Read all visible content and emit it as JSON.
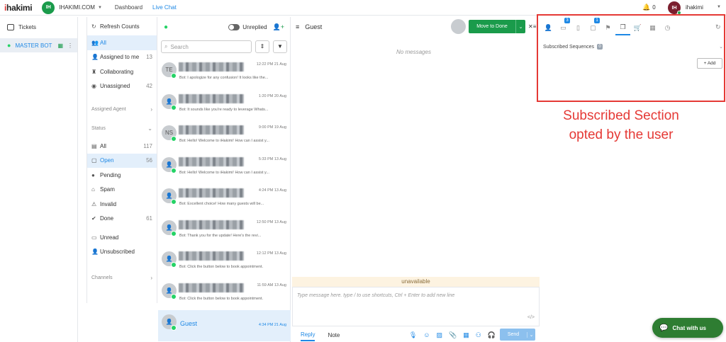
{
  "topbar": {
    "logo_prefix": "i",
    "logo_rest": "hakimi",
    "workspace_avatar": "IH",
    "workspace_name": "IHAKIMI.COM",
    "nav_dashboard": "Dashboard",
    "nav_livechat": "Live Chat",
    "notif_count": "0",
    "user_avatar": "IH",
    "user_name": "ihakimi",
    "icons": {
      "bell": "bell-icon",
      "caret": "chevron-down-icon"
    }
  },
  "left_nav": {
    "tickets": "Tickets",
    "master_bot": "MASTER BOT"
  },
  "filters": {
    "refresh": "Refresh Counts",
    "items_top": [
      {
        "label": "All",
        "count": "",
        "icon": "👥",
        "active": true
      },
      {
        "label": "Assigned to me",
        "count": "13",
        "icon": "👤",
        "active": false
      },
      {
        "label": "Collaborating",
        "count": "",
        "icon": "♜",
        "active": false
      },
      {
        "label": "Unassigned",
        "count": "42",
        "icon": "◉",
        "active": false
      }
    ],
    "assigned_agent": "Assigned Agent",
    "status": "Status",
    "status_items": [
      {
        "label": "All",
        "count": "117",
        "icon": "▤",
        "active": false
      },
      {
        "label": "Open",
        "count": "56",
        "icon": "▢",
        "active": true
      },
      {
        "label": "Pending",
        "count": "",
        "icon": "●",
        "active": false
      },
      {
        "label": "Spam",
        "count": "",
        "icon": "⌂",
        "active": false
      },
      {
        "label": "Invalid",
        "count": "",
        "icon": "⚠",
        "active": false
      },
      {
        "label": "Done",
        "count": "61",
        "icon": "✔",
        "active": false
      }
    ],
    "unread": "Unread",
    "unsubscribed": "Unsubscribed",
    "channels": "Channels"
  },
  "chat_list": {
    "unreplied": "Unreplied",
    "search_placeholder": "Search",
    "conversations": [
      {
        "initials": "TE",
        "time": "12:22 PM 21 Aug",
        "preview": "Bot: I apologize for any confusion! It looks like the..."
      },
      {
        "initials": "",
        "time": "1:20 PM 20 Aug",
        "preview": "Bot: It sounds like you're ready to leverage Whats..."
      },
      {
        "initials": "NS",
        "time": "9:00 PM 19 Aug",
        "preview": "Bot: Hello! Welcome to iHakimi! How can I assist y..."
      },
      {
        "initials": "",
        "time": "5:33 PM 13 Aug",
        "preview": "Bot: Hello! Welcome to iHakimi! How can I assist y..."
      },
      {
        "initials": "",
        "time": "4:24 PM 13 Aug",
        "preview": "Bot: Excellent choice! How many guests will be..."
      },
      {
        "initials": "",
        "time": "12:50 PM 13 Aug",
        "preview": "Bot: Thank you for the update! Here's the revi..."
      },
      {
        "initials": "",
        "time": "12:12 PM 13 Aug",
        "preview": "Bot: Click the button below to book appointment."
      },
      {
        "initials": "",
        "time": "11:59 AM 13 Aug",
        "preview": "Bot: Click the button below to book appointment."
      }
    ],
    "selected": {
      "name": "Guest",
      "time": "4:34 PM 21 Aug"
    }
  },
  "chat": {
    "title": "Guest",
    "move_to_done": "Move to Done",
    "no_messages": "No messages",
    "unavailable": "unavailable",
    "composer_placeholder": "Type message here. type / to use shortcuts, Ctrl + Enter to add new line",
    "reply": "Reply",
    "note": "Note",
    "send": "Send"
  },
  "right_panel": {
    "badges": {
      "tab2": "3",
      "tab4": "1"
    },
    "subscribed_sequences": "Subscribed Sequences",
    "subscribed_count": "0",
    "add": "+ Add"
  },
  "annotation": {
    "line1": "Subscribed Section",
    "line2": "opted by the user",
    "color": "#e53935"
  },
  "widget": {
    "label": "Chat with us"
  }
}
